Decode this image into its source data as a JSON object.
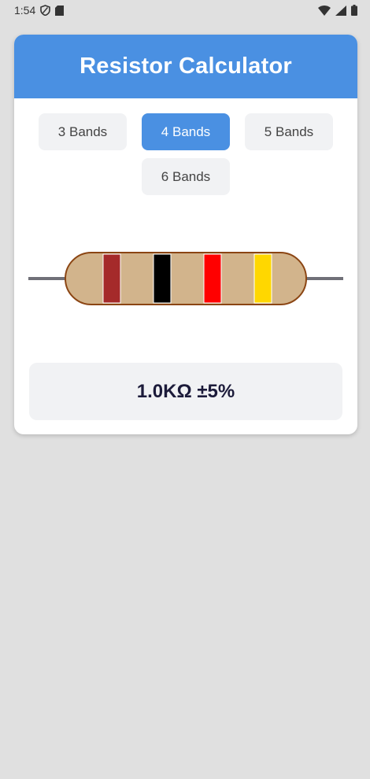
{
  "status_bar": {
    "time": "1:54",
    "icons": [
      "shield-icon",
      "sd-card-icon",
      "wifi-icon",
      "signal-icon",
      "battery-icon"
    ]
  },
  "header": {
    "title": "Resistor Calculator",
    "color": "#4a90e2"
  },
  "band_options": {
    "three": "3 Bands",
    "four": "4 Bands",
    "five": "5 Bands",
    "six": "6 Bands",
    "selected": "4 Bands"
  },
  "resistor": {
    "body_color": "#d2b48c",
    "outline_color": "#8b4513",
    "lead_color": "#707078",
    "bands": [
      {
        "name": "brown",
        "color": "#a52a2a"
      },
      {
        "name": "black",
        "color": "#000000"
      },
      {
        "name": "red",
        "color": "#ff0000"
      },
      {
        "name": "gold",
        "color": "#ffd700"
      }
    ]
  },
  "result": {
    "value": "1.0KΩ ±5%"
  }
}
